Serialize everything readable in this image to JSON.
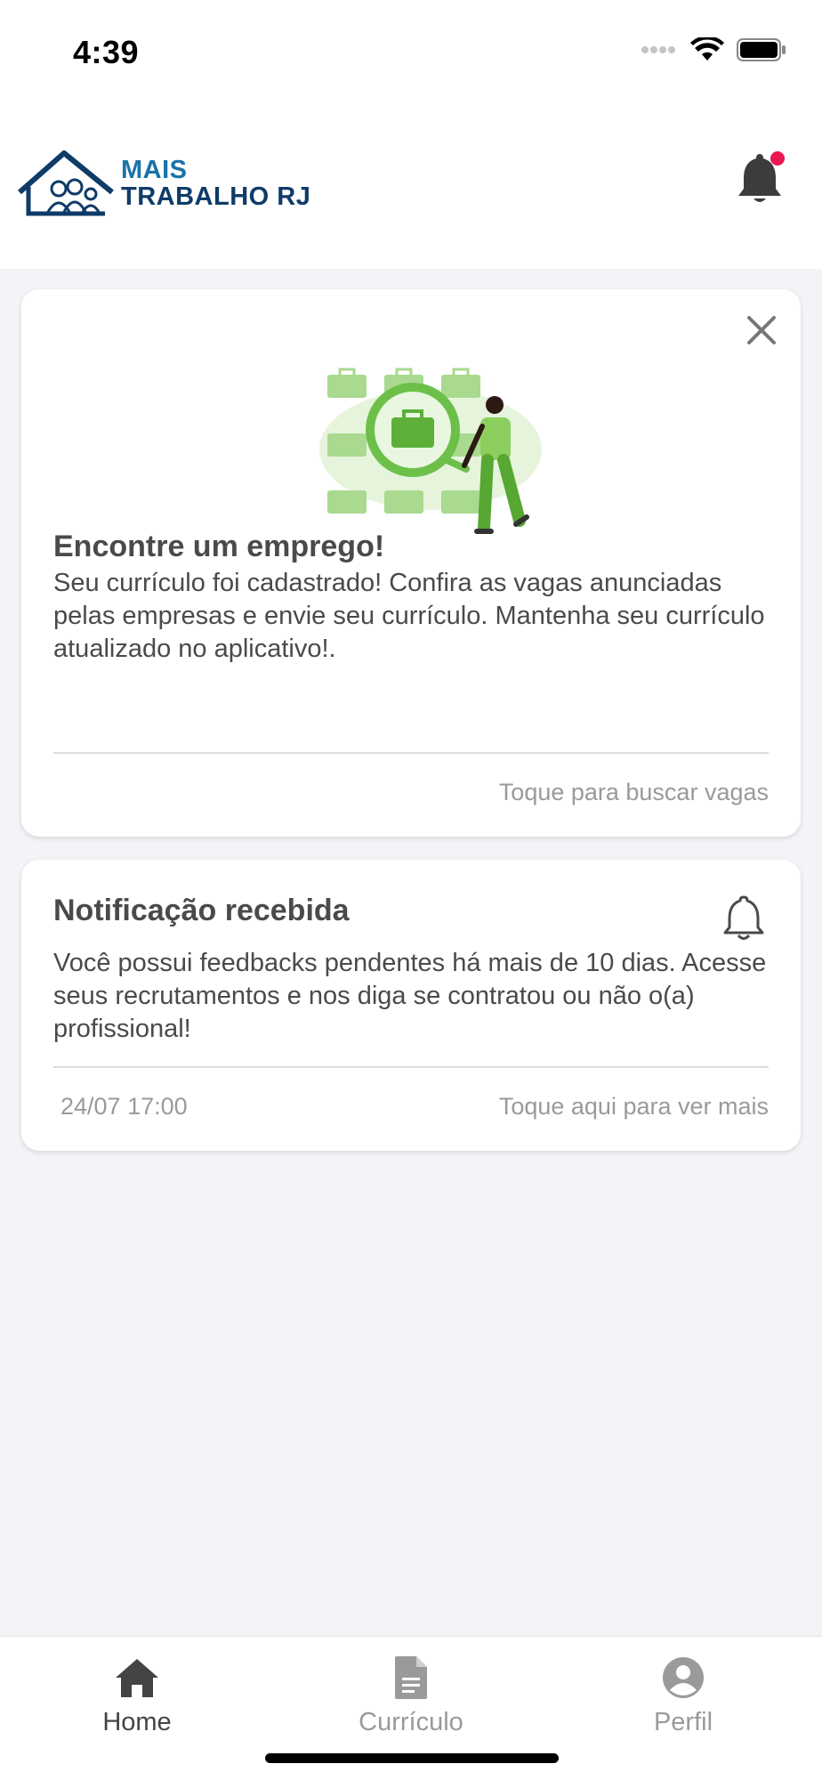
{
  "status_bar": {
    "time": "4:39"
  },
  "header": {
    "logo_line1": "MAIS",
    "logo_line2": "TRABALHO RJ",
    "notification_icon": "bell-icon",
    "has_unread": true
  },
  "job_card": {
    "title": "Encontre um emprego!",
    "body": "Seu currículo foi cadastrado! Confira as vagas anunciadas pelas empresas e envie seu currículo. Mantenha seu currículo atualizado no aplicativo!.",
    "action": "Toque para buscar vagas",
    "close_icon": "close-icon"
  },
  "notification_card": {
    "title": "Notificação recebida",
    "body": "Você possui feedbacks pendentes há mais de 10 dias. Acesse seus recrutamentos e nos diga se contratou ou não o(a) profissional!",
    "date": "24/07 17:00",
    "action": "Toque aqui para ver mais",
    "icon": "bell-outline-icon"
  },
  "bottom_nav": {
    "items": [
      {
        "label": "Home",
        "icon": "home-icon",
        "active": true
      },
      {
        "label": "Currículo",
        "icon": "document-icon",
        "active": false
      },
      {
        "label": "Perfil",
        "icon": "profile-icon",
        "active": false
      }
    ]
  },
  "colors": {
    "brand_light": "#1a72a8",
    "brand_dark": "#0f3b68",
    "badge": "#e8174f",
    "illustration_green": "#6cc04a",
    "nav_active": "#444444",
    "nav_inactive": "#9a9a9a"
  }
}
